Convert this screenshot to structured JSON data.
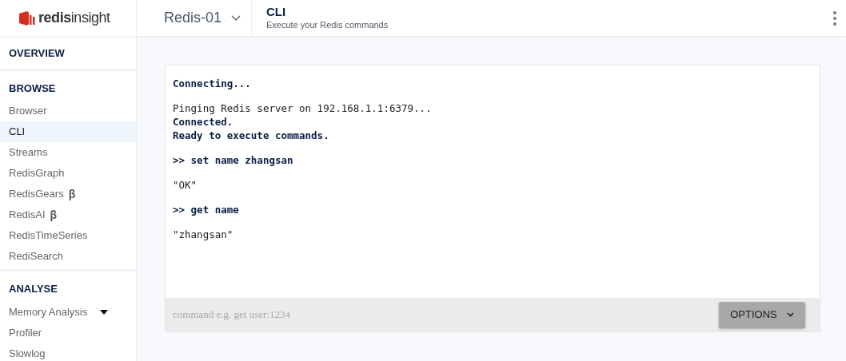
{
  "header": {
    "logo": "**redis**insight",
    "database": "Redis-01",
    "page_title": "CLI",
    "page_subtitle": "Execute your Redis commands"
  },
  "sidebar": {
    "sections": [
      {
        "title": "OVERVIEW"
      },
      {
        "title": "BROWSE",
        "items": [
          {
            "label": "Browser",
            "selected": false,
            "kind": "link"
          },
          {
            "label": "CLI",
            "selected": true,
            "kind": "link"
          },
          {
            "label": "Streams",
            "selected": false,
            "kind": "link"
          },
          {
            "label": "RedisGraph",
            "selected": false,
            "kind": "link"
          },
          {
            "label": "RedisGears",
            "badge": "β",
            "selected": false,
            "kind": "link"
          },
          {
            "label": "RedisAI",
            "badge": "β",
            "selected": false,
            "kind": "link"
          },
          {
            "label": "RedisTimeSeries",
            "selected": false,
            "kind": "link"
          },
          {
            "label": "RediSearch",
            "selected": false,
            "kind": "link"
          }
        ]
      },
      {
        "title": "ANALYSE",
        "items": [
          {
            "label": "Memory Analysis",
            "selected": false,
            "kind": "dropdown"
          },
          {
            "label": "Profiler",
            "selected": false,
            "kind": "link"
          },
          {
            "label": "Slowlog",
            "selected": false,
            "kind": "link"
          }
        ]
      }
    ]
  },
  "terminal": {
    "blocks": [
      [
        {
          "text": "Connecting...",
          "bold": true
        }
      ],
      [
        {
          "text": "Pinging Redis server on 192.168.1.1:6379...",
          "bold": false
        },
        {
          "text": "Connected.",
          "bold": true
        },
        {
          "text": "Ready to execute commands.",
          "bold": true
        }
      ],
      [
        {
          "text": ">> set name zhangsan",
          "bold": true
        }
      ],
      [
        {
          "text": "\"OK\"",
          "bold": false
        }
      ],
      [
        {
          "text": ">> get name",
          "bold": true
        }
      ],
      [
        {
          "text": "\"zhangsan\"",
          "bold": false
        }
      ]
    ],
    "input_placeholder": "command e.g. get user:1234",
    "options_button": "OPTIONS"
  }
}
